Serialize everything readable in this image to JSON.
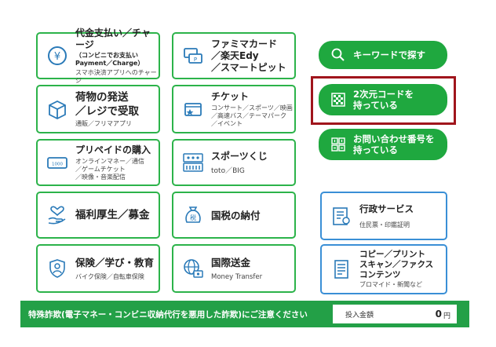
{
  "tiles": {
    "payment": {
      "title": "代金支払い／チャージ",
      "sub1": "（コンビニでお支払い\nPayment／Charge）",
      "sub2": "スマホ決済アプリへのチャージ",
      "icon": "yen-coin-icon"
    },
    "famima_card": {
      "title": "ファミマカード\n／楽天Edy\n／スマートピット",
      "icon": "card-icon"
    },
    "parcel": {
      "title": "荷物の発送\n／レジで受取",
      "sub": "通販／フリマアプリ",
      "icon": "parcel-box-icon"
    },
    "ticket": {
      "title": "チケット",
      "sub": "コンサート／スポーツ／映画\n／高速バス／テーマパーク\n／イベント",
      "icon": "ticket-icon"
    },
    "prepaid": {
      "title": "プリペイドの購入",
      "sub": "オンラインマネー／通信\n／ゲームチケット\n／映像・音楽配信",
      "icon": "prepaid-card-icon"
    },
    "sports_lottery": {
      "title": "スポーツくじ",
      "sub": "toto／BIG",
      "icon": "toto-big-icon"
    },
    "welfare": {
      "title": "福利厚生／募金",
      "icon": "hand-heart-icon"
    },
    "national_tax": {
      "title": "国税の納付",
      "icon": "tax-bag-icon"
    },
    "admin_service": {
      "title": "行政サービス",
      "sub": "住民票・印鑑証明",
      "icon": "certificate-icon"
    },
    "insurance": {
      "title": "保険／学び・教育",
      "sub": "バイク保険／自転車保険",
      "icon": "shield-person-icon"
    },
    "remittance": {
      "title": "国際送金",
      "sub": "Money Transfer",
      "icon": "globe-money-icon"
    },
    "copy_print": {
      "title": "コピー／プリント\nスキャン／ファクス\nコンテンツ",
      "sub": "ブロマイド・新聞など",
      "icon": "document-icon"
    }
  },
  "pills": {
    "keyword_search": {
      "label": "キーワードで探す",
      "icon": "search-icon"
    },
    "qr_code": {
      "label": "2次元コードを\n持っている",
      "icon": "qr-code-icon"
    },
    "inquiry_number": {
      "label": "お問い合わせ番号を\n持っている",
      "icon": "number-grid-icon"
    }
  },
  "footer": {
    "warning": "特殊詐欺(電子マネー・コンビニ収納代行を悪用した詐欺)にご注意ください",
    "amount_label": "投入金額",
    "amount_value": "0",
    "amount_unit": "円"
  },
  "colors": {
    "accent_green": "#1fa83f",
    "tile_border_green": "#2cb34a",
    "tile_border_blue": "#3a8fd6",
    "highlight_red": "#a0151c"
  }
}
